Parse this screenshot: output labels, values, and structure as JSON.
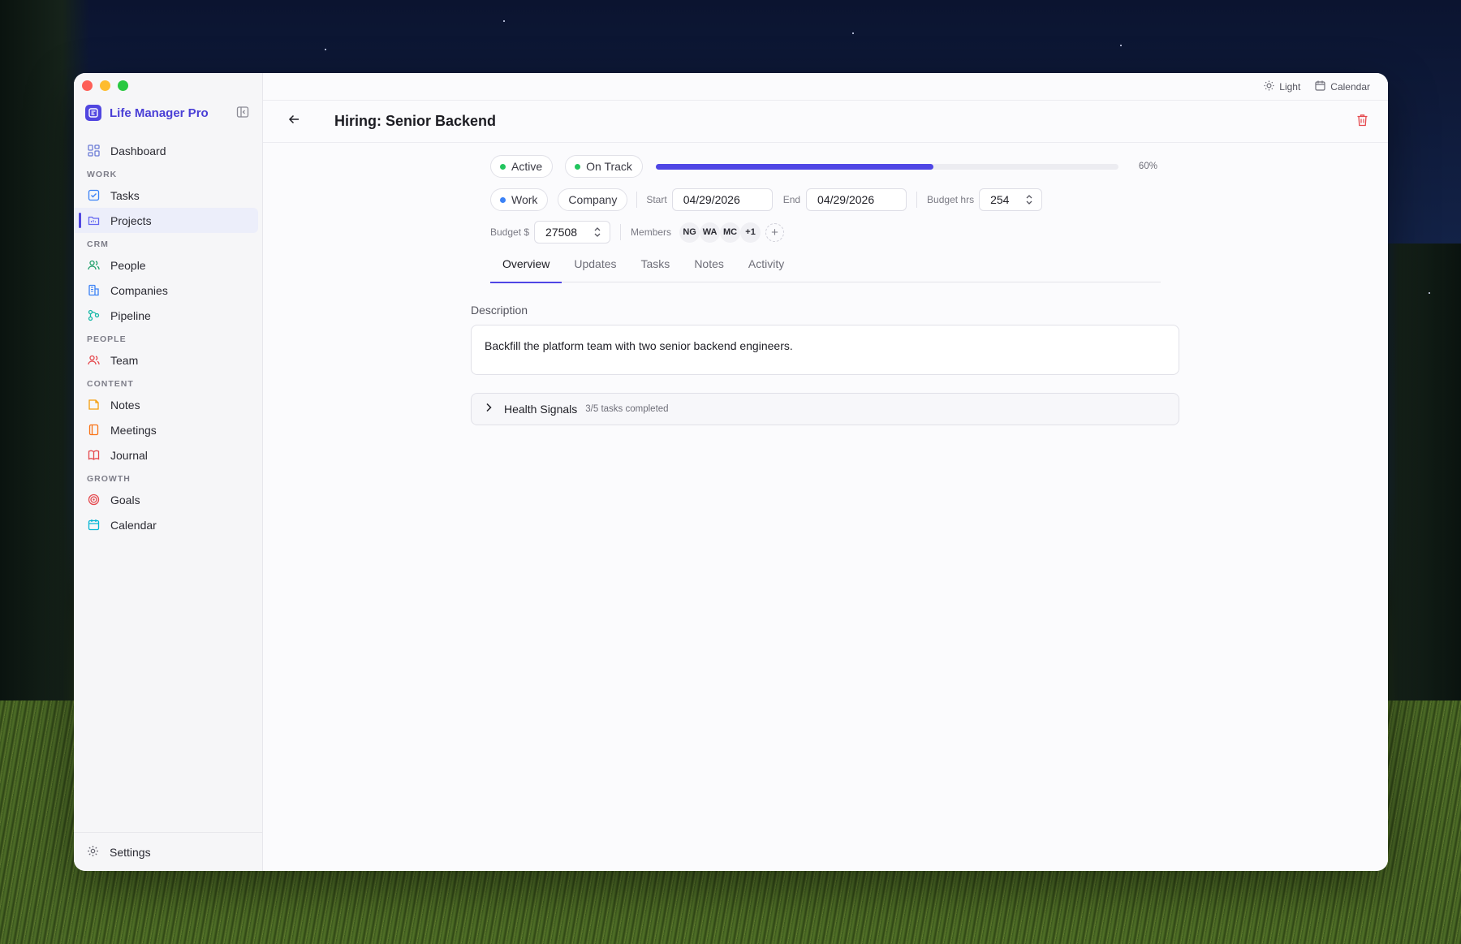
{
  "app": {
    "name": "Life Manager Pro"
  },
  "sidebar": {
    "items": [
      {
        "type": "item",
        "label": "Dashboard",
        "icon": "dashboard-icon"
      },
      {
        "type": "section",
        "label": "WORK"
      },
      {
        "type": "item",
        "label": "Tasks",
        "icon": "checkbox-icon"
      },
      {
        "type": "item",
        "label": "Projects",
        "icon": "folder-icon",
        "active": true
      },
      {
        "type": "section",
        "label": "CRM"
      },
      {
        "type": "item",
        "label": "People",
        "icon": "people-icon"
      },
      {
        "type": "item",
        "label": "Companies",
        "icon": "building-icon"
      },
      {
        "type": "item",
        "label": "Pipeline",
        "icon": "pipeline-icon"
      },
      {
        "type": "section",
        "label": "PEOPLE"
      },
      {
        "type": "item",
        "label": "Team",
        "icon": "team-icon"
      },
      {
        "type": "section",
        "label": "CONTENT"
      },
      {
        "type": "item",
        "label": "Notes",
        "icon": "note-icon"
      },
      {
        "type": "item",
        "label": "Meetings",
        "icon": "meetings-icon"
      },
      {
        "type": "item",
        "label": "Journal",
        "icon": "book-icon"
      },
      {
        "type": "section",
        "label": "GROWTH"
      },
      {
        "type": "item",
        "label": "Goals",
        "icon": "target-icon"
      },
      {
        "type": "item",
        "label": "Calendar",
        "icon": "calendar-icon"
      }
    ],
    "settings_label": "Settings"
  },
  "topbar": {
    "theme_label": "Light",
    "calendar_label": "Calendar"
  },
  "project": {
    "title": "Hiring: Senior Backend",
    "status": "Active",
    "health": "On Track",
    "progress_pct": 60,
    "progress_label": "60%",
    "area": "Work",
    "company": "Company",
    "start_label": "Start",
    "start_date": "04/29/2026",
    "end_label": "End",
    "end_date": "04/29/2026",
    "budget_hrs_label": "Budget hrs",
    "budget_hrs": "254",
    "budget_usd_label": "Budget $",
    "budget_usd": "27508",
    "members_label": "Members",
    "members": [
      "NG",
      "WA",
      "MC",
      "+1"
    ],
    "add_member_symbol": "+"
  },
  "tabs": [
    "Overview",
    "Updates",
    "Tasks",
    "Notes",
    "Activity"
  ],
  "overview": {
    "description_label": "Description",
    "description": "Backfill the platform team with two senior backend engineers.",
    "health_title": "Health Signals",
    "health_sub": "3/5 tasks completed"
  },
  "colors": {
    "accent": "#4f46e5",
    "status_green": "#22c55e",
    "area_blue": "#3b82f6",
    "danger": "#e5484d"
  }
}
